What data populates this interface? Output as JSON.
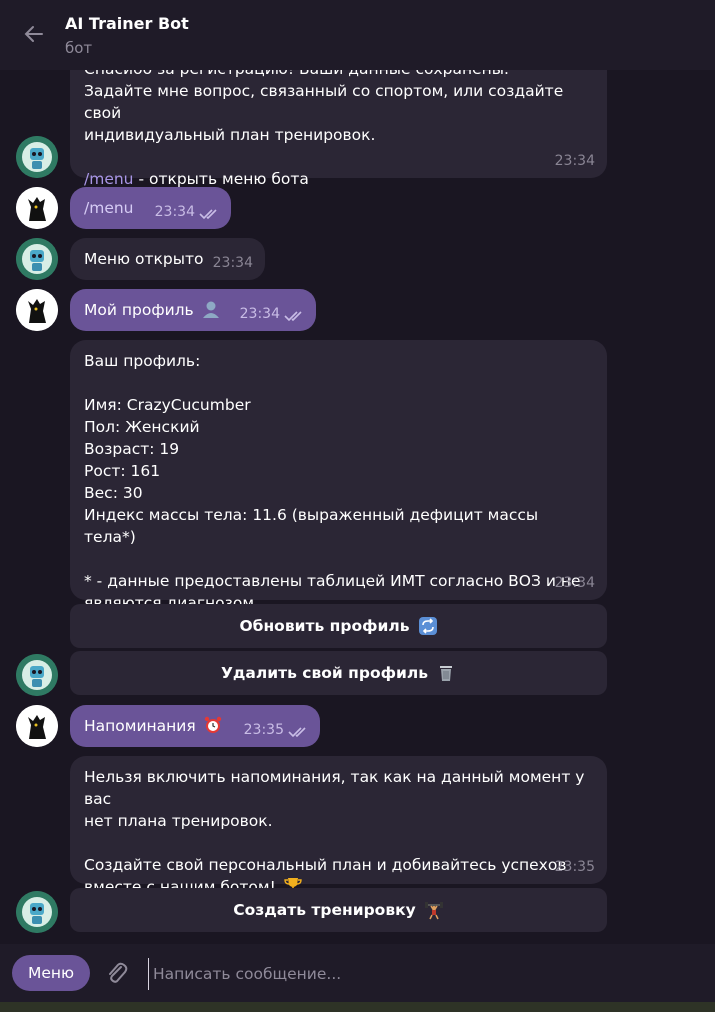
{
  "header": {
    "title": "AI Trainer Bot",
    "subtitle": "бот"
  },
  "messages": {
    "m1_line1": "Спасибо за регистрацию! Ваши данные сохранены.",
    "m1_line2": "Задайте мне вопрос, связанный со спортом, или создайте свой\nиндивидуальный план тренировок.",
    "m1_cmd": "/menu",
    "m1_rest": " - открыть меню бота",
    "m1_time": "23:34",
    "m2_text": "/menu",
    "m2_time": "23:34",
    "m3_text": "Меню открыто",
    "m3_time": "23:34",
    "m4_text": "Мой профиль",
    "m4_time": "23:34",
    "m5_text": "Ваш профиль:\n\nИмя: CrazyCucumber\nПол: Женский\nВозраст: 19\nРост: 161\nВес: 30\nИндекс массы тела: 11.6 (выраженный дефицит массы тела*)\n\n* - данные предоставлены таблицей ИМТ согласно ВОЗ и не\nявляются диагнозом",
    "m5_time": "23:34",
    "m6_text": "Напоминания",
    "m6_time": "23:35",
    "m7_text": "Нельзя включить напоминания, так как на данный момент у вас\nнет плана тренировок.\n\nСоздайте свой персональный план и добивайтесь успехов\nвместе с нашим ботом!",
    "m7_time": "23:35"
  },
  "keyboard": {
    "update_profile": "Обновить профиль",
    "delete_profile": "Удалить свой профиль",
    "create_training": "Создать тренировку"
  },
  "composer": {
    "menu_label": "Меню",
    "placeholder": "Написать сообщение..."
  },
  "icons": {
    "back": "arrow-left-icon",
    "attach": "paperclip-icon",
    "profile_emoji": "bust-silhouette",
    "update_emoji": "repeat-arrows",
    "delete_emoji": "wastebasket",
    "reminder_emoji": "alarm-clock",
    "trophy_emoji": "trophy",
    "training_emoji": "weight-lifter"
  },
  "colors": {
    "background": "#1a1622",
    "incoming_bubble": "#2b2635",
    "outgoing_bubble": "#6a5498",
    "accent": "#a996e6"
  }
}
